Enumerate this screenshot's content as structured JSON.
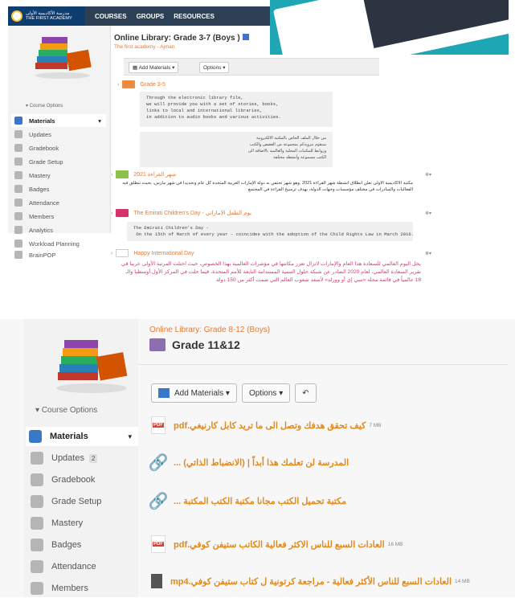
{
  "top": {
    "brand_ar": "مدرسة الأكاديمية الأولى",
    "brand_en": "THE FIRST ACADEMY",
    "nav": [
      "COURSES",
      "GROUPS",
      "RESOURCES"
    ],
    "course_options": "Course Options",
    "sidebar": [
      "Materials",
      "Updates",
      "Gradebook",
      "Grade Setup",
      "Mastery",
      "Badges",
      "Attendance",
      "Members",
      "Analytics",
      "Workload Planning",
      "BrainPOP"
    ],
    "title": "Online Library: Grade 3-7 (Boys )",
    "subtitle": "The first academy - Ajman",
    "add_materials": "Add Materials",
    "options": "Options",
    "folder1": "Grade 3-5",
    "folder1_desc_en": "Through the electronic library file,\nwe will provide you with a set of stories, books,\nlinks to local and international libraries,\nin addition to audio books and various activities.",
    "folder1_desc_ar": "من خلال الملف الخاص بالمكتبة الالكترونية\nسنقوم بتزويدكم بمجموعة من القصص والكتب\nوروابط للمكتبات المحلية والعالمية بالاضافة الى\nالكتب مسموعة وأنشطة مختلفة",
    "folder2": "شهر القراءة 2021",
    "folder2_desc": "مكتبة الأكاديمية الأولى تعلن انطلاق أنشطة شهر القراءة 2021 ,وهو شهر تحتفي به دولة الإمارات العربية المتحدة كل عام وتحديداً في شهر مارس، بحيث تنطلق فيه الفعاليات والمبادرات في مختلف مؤسسات وجهات الدولة، بهدف ترسيخ القراءة في المجتمع",
    "folder3": "The Emirati Children's Day - يوم الطفل الاماراتي",
    "folder3_desc": "The Emirati Children's Day -\n On the 15th of March of every year - coincides with the adoption of the Child Rights Law in March 2016.",
    "folder4": "Happy International Day",
    "folder4_desc": "يحل اليوم العالمي للسعادة هذا العام والإمارات لاتزال تعزز مكانتها في مؤشرات العالمية بهذا الخصوص، حيث احتلت المرتبة الأولى عربيا في تقرير السعادة العالمي، لعام 2020 الصادر عن شبكة حلول التنمية المستدامة التابعة للأمم المتحدة، فيما حلت في المركز الأول أوسطيا والـ 18 عالمياً في قائمة مجلة «سي إي أو وورلد» لأسعد شعوب العالم التي ضمت أكثر من 150 دولة"
  },
  "bottom": {
    "course_options": "Course Options",
    "sidebar": [
      "Materials",
      "Updates",
      "Gradebook",
      "Grade Setup",
      "Mastery",
      "Badges",
      "Attendance",
      "Members"
    ],
    "updates_count": "2",
    "crumb": "Online Library: Grade 8-12 (Boys)",
    "title": "Grade 11&12",
    "add_materials": "Add Materials",
    "options": "Options",
    "rows": [
      {
        "text": "كيف تحقق هدفك وتصل الى ما تريد كابل كارنيغي.pdf",
        "size": "7 MB",
        "icon": "pdf"
      },
      {
        "text": "المدرسة لن تعلمك هذا أبداً | (الانضباط الذاتي) ...",
        "size": "",
        "icon": "link"
      },
      {
        "text": "مكتبة تحميل الكتب مجانا مكتبة الكتب المكتبة ...",
        "size": "",
        "icon": "link"
      },
      {
        "text": "العادات السبع للناس الاكثر فعالية الكاتب ستيفن كوفي.pdf",
        "size": "16 MB",
        "icon": "pdf"
      },
      {
        "text": "العادات السبع للناس الأكثر فعالية - مراجعة كرتونية ل كتاب ستيفن كوفي.mp4",
        "size": "14 MB",
        "icon": "doc"
      }
    ]
  },
  "colors": {
    "accent_orange": "#e07b39",
    "nav_bg": "#2d3f55",
    "link_orange": "#e08a1e",
    "pink_text": "#e0357a"
  }
}
